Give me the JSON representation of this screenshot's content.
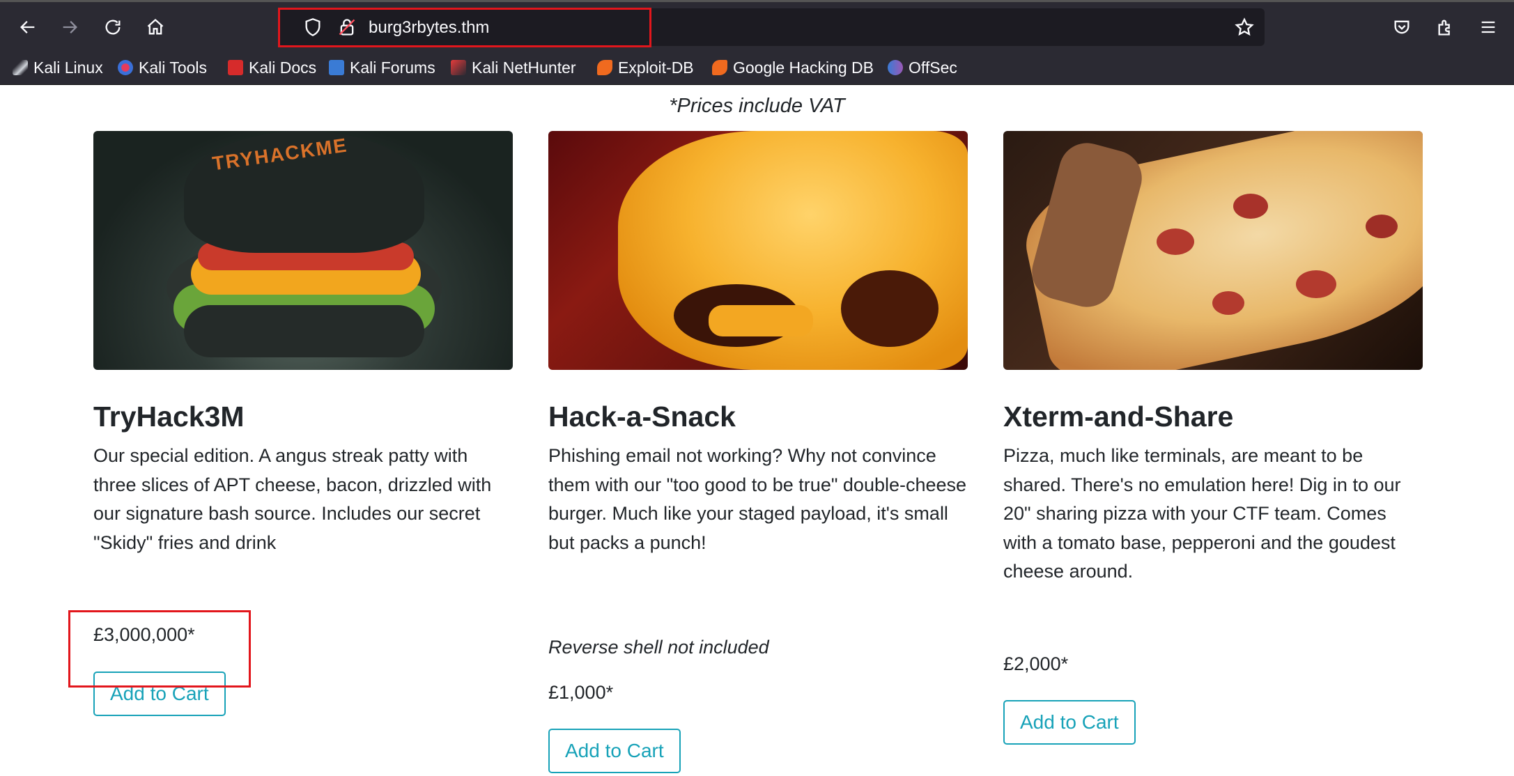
{
  "browser": {
    "url": "burg3rbytes.thm",
    "bookmarks": [
      {
        "label": "Kali Linux",
        "icon": "kali-dragon-icon"
      },
      {
        "label": "Kali Tools",
        "icon": "kali-tools-icon"
      },
      {
        "label": "Kali Docs",
        "icon": "kali-docs-icon"
      },
      {
        "label": "Kali Forums",
        "icon": "kali-forums-icon"
      },
      {
        "label": "Kali NetHunter",
        "icon": "kali-nethunter-icon"
      },
      {
        "label": "Exploit-DB",
        "icon": "exploit-db-icon"
      },
      {
        "label": "Google Hacking DB",
        "icon": "ghdb-icon"
      },
      {
        "label": "OffSec",
        "icon": "offsec-icon"
      }
    ],
    "highlight_color": "#e2161c"
  },
  "page": {
    "vat_note": "*Prices include VAT",
    "accent_color": "#17a2b8",
    "products": [
      {
        "title": "TryHack3M",
        "description": "Our special edition. A angus streak patty with three slices of APT cheese, bacon, drizzled with our signature bash source. Includes our secret \"Skidy\" fries and drink",
        "note": "",
        "price": "£3,000,000*",
        "button_label": "Add to Cart",
        "image_label": "TRYHACKME"
      },
      {
        "title": "Hack-a-Snack",
        "description": "Phishing email not working? Why not convince them with our \"too good to be true\" double-cheese burger. Much like your staged payload, it's small but packs a punch!",
        "note": "Reverse shell not included",
        "price": "£1,000*",
        "button_label": "Add to Cart"
      },
      {
        "title": "Xterm-and-Share",
        "description": "Pizza, much like terminals, are meant to be shared. There's no emulation here! Dig in to our 20\" sharing pizza with your CTF team. Comes with a tomato base, pepperoni and the goudest cheese around.",
        "note": "",
        "price": "£2,000*",
        "button_label": "Add to Cart"
      }
    ]
  }
}
